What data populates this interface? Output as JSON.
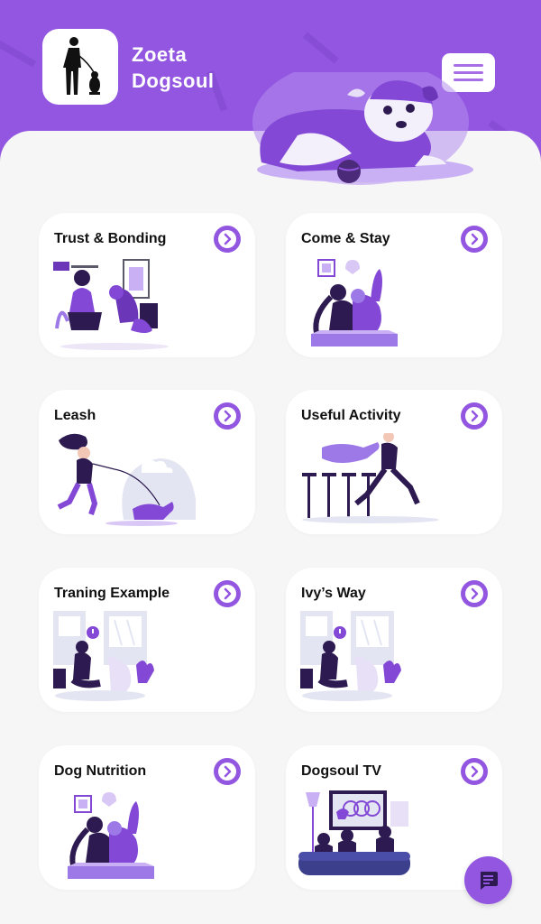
{
  "app": {
    "brand_line1": "Zoeta",
    "brand_line2": "Dogsoul",
    "accent_color": "#9256e0"
  },
  "header": {
    "menu_icon": "hamburger-menu-icon",
    "logo_icon": "person-with-dog-logo-icon"
  },
  "cards": [
    {
      "title": "Trust & Bonding",
      "icon": "chevron-right-circle-icon"
    },
    {
      "title": "Come & Stay",
      "icon": "chevron-right-circle-icon"
    },
    {
      "title": "Leash",
      "icon": "chevron-right-circle-icon"
    },
    {
      "title": "Useful Activity",
      "icon": "chevron-right-circle-icon"
    },
    {
      "title": "Traning Example",
      "icon": "chevron-right-circle-icon"
    },
    {
      "title": "Ivy’s Way",
      "icon": "chevron-right-circle-icon"
    },
    {
      "title": "Dog Nutrition",
      "icon": "chevron-right-circle-icon"
    },
    {
      "title": "Dogsoul TV",
      "icon": "chevron-right-circle-icon"
    }
  ],
  "chat": {
    "icon": "chat-bubble-icon"
  }
}
